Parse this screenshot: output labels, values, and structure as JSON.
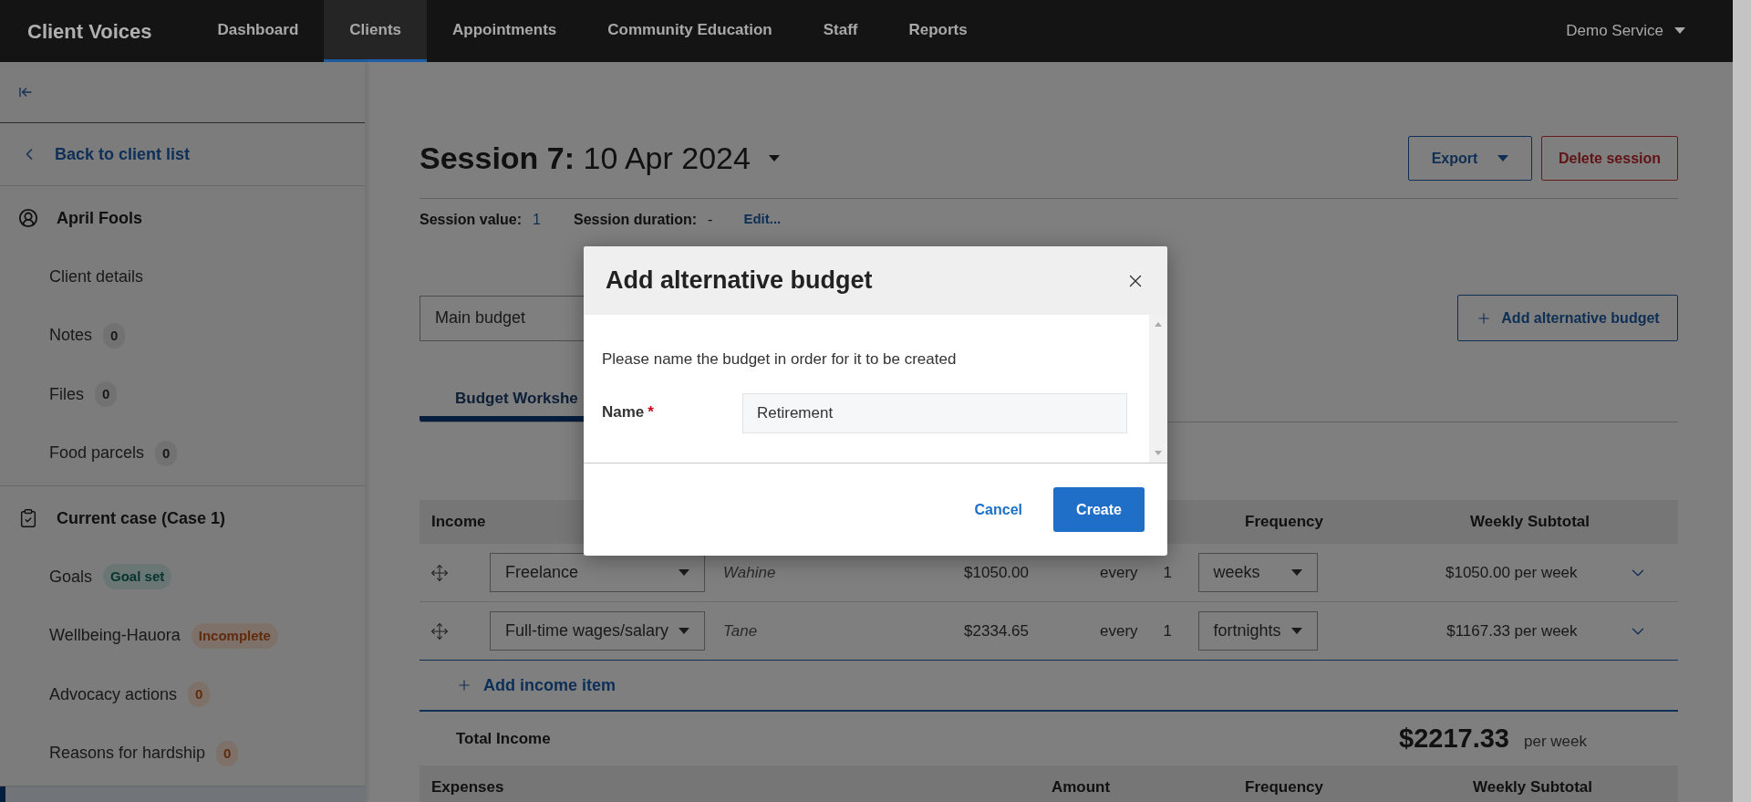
{
  "nav": {
    "brand": "Client Voices",
    "items": [
      {
        "label": "Dashboard",
        "selected": false
      },
      {
        "label": "Clients",
        "selected": true
      },
      {
        "label": "Appointments",
        "selected": false
      },
      {
        "label": "Community Education",
        "selected": false
      },
      {
        "label": "Staff",
        "selected": false
      },
      {
        "label": "Reports",
        "selected": false
      }
    ],
    "account": "Demo Service"
  },
  "sidebar": {
    "back_link": "Back to client list",
    "sections": [
      {
        "kind": "client",
        "title": "April Fools",
        "items": [
          {
            "label": "Client details"
          },
          {
            "label": "Notes",
            "badge": {
              "text": "0",
              "kind": "neutral"
            }
          },
          {
            "label": "Files",
            "badge": {
              "text": "0",
              "kind": "neutral"
            }
          },
          {
            "label": "Food parcels",
            "badge": {
              "text": "0",
              "kind": "neutral"
            }
          }
        ]
      },
      {
        "kind": "case",
        "title": "Current case (Case 1)",
        "items": [
          {
            "label": "Goals",
            "badge": {
              "text": "Goal set",
              "kind": "success"
            }
          },
          {
            "label": "Wellbeing-Hauora",
            "badge": {
              "text": "Incomplete",
              "kind": "warning"
            }
          },
          {
            "label": "Advocacy actions",
            "badge": {
              "text": "0",
              "kind": "warning"
            }
          },
          {
            "label": "Reasons for hardship",
            "badge": {
              "text": "0",
              "kind": "warning"
            }
          }
        ]
      }
    ]
  },
  "session": {
    "title": "Session 7:",
    "date": "10 Apr 2024",
    "export_button": "Export",
    "delete_button": "Delete session",
    "value_label": "Session value:",
    "value": "1",
    "duration_label": "Session duration:",
    "duration": "-",
    "edit_link": "Edit..."
  },
  "budget": {
    "select": "Main budget",
    "add_button": "Add alternative budget",
    "tabs": [
      {
        "label": "Budget Workshe",
        "selected": true
      }
    ]
  },
  "income": {
    "columns": {
      "label": "Income",
      "frequency": "Frequency",
      "subtotal": "Weekly Subtotal"
    },
    "rows": [
      {
        "category": "Freelance",
        "person": "Wahine",
        "amount": "$1050.00",
        "every": "every",
        "count": "1",
        "frequency": "weeks",
        "subtotal": "$1050.00 per week"
      },
      {
        "category": "Full-time wages/salary",
        "person": "Tane",
        "amount": "$2334.65",
        "every": "every",
        "count": "1",
        "frequency": "fortnights",
        "subtotal": "$1167.33 per week"
      }
    ],
    "add_item": "Add income item",
    "total": {
      "label": "Total Income",
      "amount": "$2217.33",
      "unit": "per week"
    }
  },
  "expenses": {
    "columns": {
      "label": "Expenses",
      "amount": "Amount",
      "frequency": "Frequency",
      "subtotal": "Weekly Subtotal"
    }
  },
  "modal": {
    "title": "Add alternative budget",
    "message": "Please name the budget in order for it to be created",
    "field": {
      "label": "Name",
      "required": true,
      "required_mark": "*",
      "value": "Retirement"
    },
    "cancel": "Cancel",
    "create": "Create"
  }
}
